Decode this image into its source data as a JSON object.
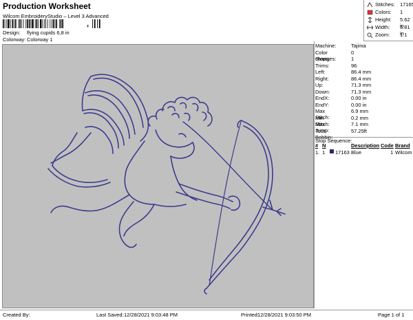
{
  "header": {
    "title": "Production Worksheet",
    "subtitle": "Wilcom EmbroideryStudio – Level 3 Advanced",
    "barcode_suffix": ",",
    "design_label": "Design:",
    "design_value": "flying cupids 6,8 in",
    "colorway_label": "Colorway:",
    "colorway_value": "Colorway 1"
  },
  "summary": {
    "stitches_label": "Stitches:",
    "stitches_value": "17165",
    "colors_label": "Colors:",
    "colors_value": "1",
    "height_label": "Height:",
    "height_value": "5.62 in",
    "width_label": "Width:",
    "width_value": "6.81 in",
    "zoom_label": "Zoom:",
    "zoom_value": "1:1"
  },
  "machine_info": [
    {
      "label": "Machine:",
      "value": "Tajima"
    },
    {
      "label": "Color changes:",
      "value": "0"
    },
    {
      "label": "Stops:",
      "value": "1"
    },
    {
      "label": "Trims:",
      "value": "96"
    },
    {
      "label": "Left:",
      "value": "86.4 mm"
    },
    {
      "label": "Right:",
      "value": "86.4 mm"
    },
    {
      "label": "Up:",
      "value": "71.3 mm"
    },
    {
      "label": "Down:",
      "value": "71.3 mm"
    },
    {
      "label": "EndX:",
      "value": "0.00 in"
    },
    {
      "label": "EndY:",
      "value": "0.00 in"
    },
    {
      "label": "Max Stitch:",
      "value": "6.9 mm"
    },
    {
      "label": "Min Stitch:",
      "value": "0.2 mm"
    },
    {
      "label": "Max Jump:",
      "value": "7.1 mm"
    },
    {
      "label": "Total Bobbin:",
      "value": "57.25ft"
    }
  ],
  "stop_sequence": {
    "title": "Stop Sequence:",
    "headers": {
      "num": "#",
      "n": "N",
      "stitches": "",
      "description": "Description",
      "code": "Code",
      "brand": "Brand"
    },
    "rows": [
      {
        "num": "1.",
        "n": "1",
        "color": "#2a2a6e",
        "stitches": "17163",
        "description": "Blue",
        "code": "1",
        "brand": "Wilcom"
      }
    ]
  },
  "design_colors": {
    "thread": "#3b3b8f",
    "background": "#c0c0c0"
  },
  "footer": {
    "created_by": "Created By:",
    "last_saved_label": "Last Saved:",
    "last_saved_value": "12/28/2021 9:03:48 PM",
    "printed_label": "Printed:",
    "printed_value": "12/28/2021 9:03:50 PM",
    "page": "Page 1 of 1"
  }
}
